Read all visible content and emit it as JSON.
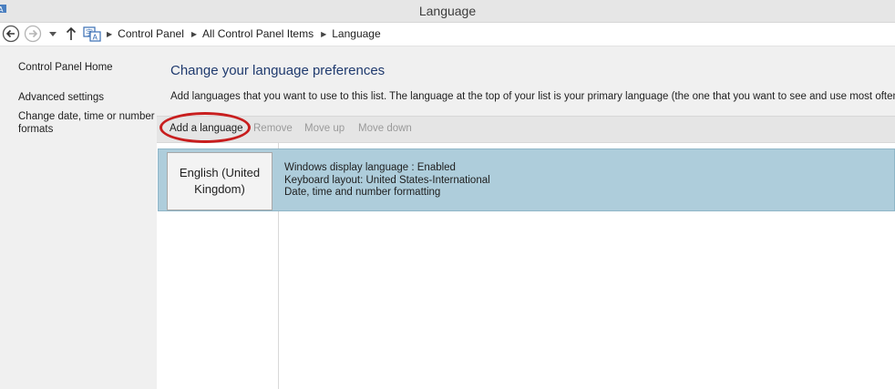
{
  "window": {
    "title": "Language"
  },
  "addressbar": {
    "breadcrumbs": [
      "Control Panel",
      "All Control Panel Items",
      "Language"
    ]
  },
  "sidebar": {
    "items": [
      {
        "label": "Control Panel Home"
      },
      {
        "label": "Advanced settings"
      },
      {
        "label": "Change date, time or number formats"
      }
    ]
  },
  "main": {
    "heading": "Change your language preferences",
    "description": "Add languages that you want to use to this list. The language at the top of your list is your primary language (the one that you want to see and use most often).",
    "toolbar": {
      "add_label": "Add a language",
      "remove_label": "Remove",
      "move_up_label": "Move up",
      "move_down_label": "Move down"
    },
    "languages": [
      {
        "name": "English (United Kingdom)",
        "details": [
          "Windows display language : Enabled",
          "Keyboard layout: United States-International",
          "Date, time and number formatting"
        ]
      }
    ]
  },
  "colors": {
    "highlight_ring": "#c81e1e",
    "selected_row": "#aecddb",
    "heading": "#1f3a6e"
  },
  "icons": [
    "back-arrow-icon",
    "forward-arrow-icon",
    "recent-dropdown-icon",
    "up-arrow-icon",
    "language-icon"
  ]
}
